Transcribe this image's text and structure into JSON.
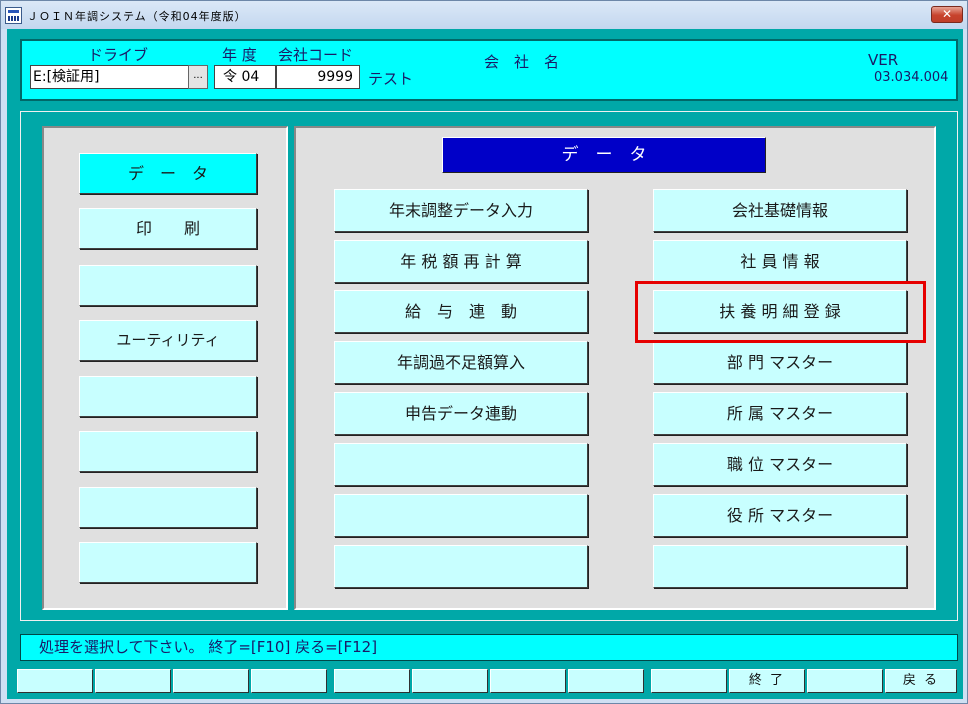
{
  "window": {
    "title": "ＪＯＩＮ年調システム（令和04年度版）",
    "close_label": "✕"
  },
  "header": {
    "drive_label": "ドライブ",
    "drive_value": "E:[検証用]",
    "browse_label": "...",
    "year_label": "年 度",
    "year_value": "令 04",
    "company_code_label": "会社コード",
    "company_code_value": "9999",
    "company_name_value": "テスト",
    "company_name_label": "会　社　名",
    "ver_label": "VER",
    "ver_value": "03.034.004"
  },
  "menu": {
    "items": [
      "デ　ー　タ",
      "印　　刷",
      "",
      "ユーティリティ",
      "",
      "",
      "",
      ""
    ],
    "active_index": 0
  },
  "section": {
    "title": "デ　ー　タ",
    "left_buttons": [
      "年末調整データ入力",
      "年 税 額 再 計 算",
      "給　与　連　動",
      "年調過不足額算入",
      "申告データ連動",
      "",
      "",
      ""
    ],
    "right_buttons": [
      "会社基礎情報",
      "社 員 情 報",
      "扶 養 明 細 登 録",
      "部 門 マスター",
      "所 属 マスター",
      "職 位 マスター",
      "役 所 マスター",
      ""
    ]
  },
  "status": {
    "message": "処理を選択して下さい。 終了=[F10]  戻る=[F12]"
  },
  "function_keys": [
    "",
    "",
    "",
    "",
    "",
    "",
    "",
    "",
    "",
    "終 了",
    "",
    "戻 る"
  ],
  "colors": {
    "highlight": "#e60000",
    "section_title_bg": "#0000c8",
    "button_bg": "#c8ffff",
    "active_bg": "#00ffff"
  }
}
